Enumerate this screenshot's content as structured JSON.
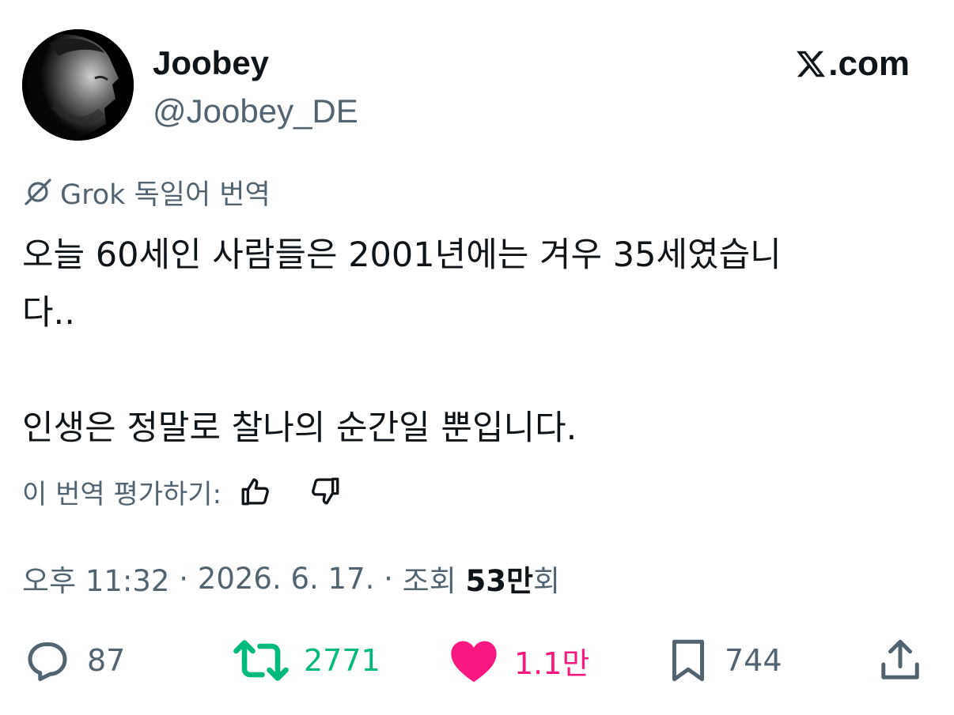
{
  "author": {
    "display_name": "Joobey",
    "handle": "@Joobey_DE"
  },
  "brand": {
    "name": ".com",
    "logo_icon": "x-logo-icon"
  },
  "translation": {
    "label": "Grok 독일어 번역",
    "icon": "grok-icon",
    "rate_label": "이 번역 평가하기:"
  },
  "tweet": {
    "lines": [
      "오늘 60세인 사람들은 2001년에는 겨우 35세였습니",
      "다..",
      "인생은 정말로 찰나의 순간일 뿐입니다."
    ]
  },
  "meta": {
    "time": "오후 11:32",
    "separator": " · ",
    "date": "2026. 6. 17.",
    "views_prefix": "조회 ",
    "views_count": "53만",
    "views_suffix": "회"
  },
  "actions": {
    "reply": {
      "count": "87",
      "icon": "reply-icon",
      "color": "#536471"
    },
    "repost": {
      "count": "2771",
      "icon": "repost-icon",
      "color": "#00ba7c"
    },
    "like": {
      "count": "1.1만",
      "icon": "heart-icon",
      "color": "#f91880"
    },
    "bookmark": {
      "count": "744",
      "icon": "bookmark-icon",
      "color": "#536471"
    },
    "share": {
      "icon": "share-icon",
      "color": "#536471"
    }
  }
}
